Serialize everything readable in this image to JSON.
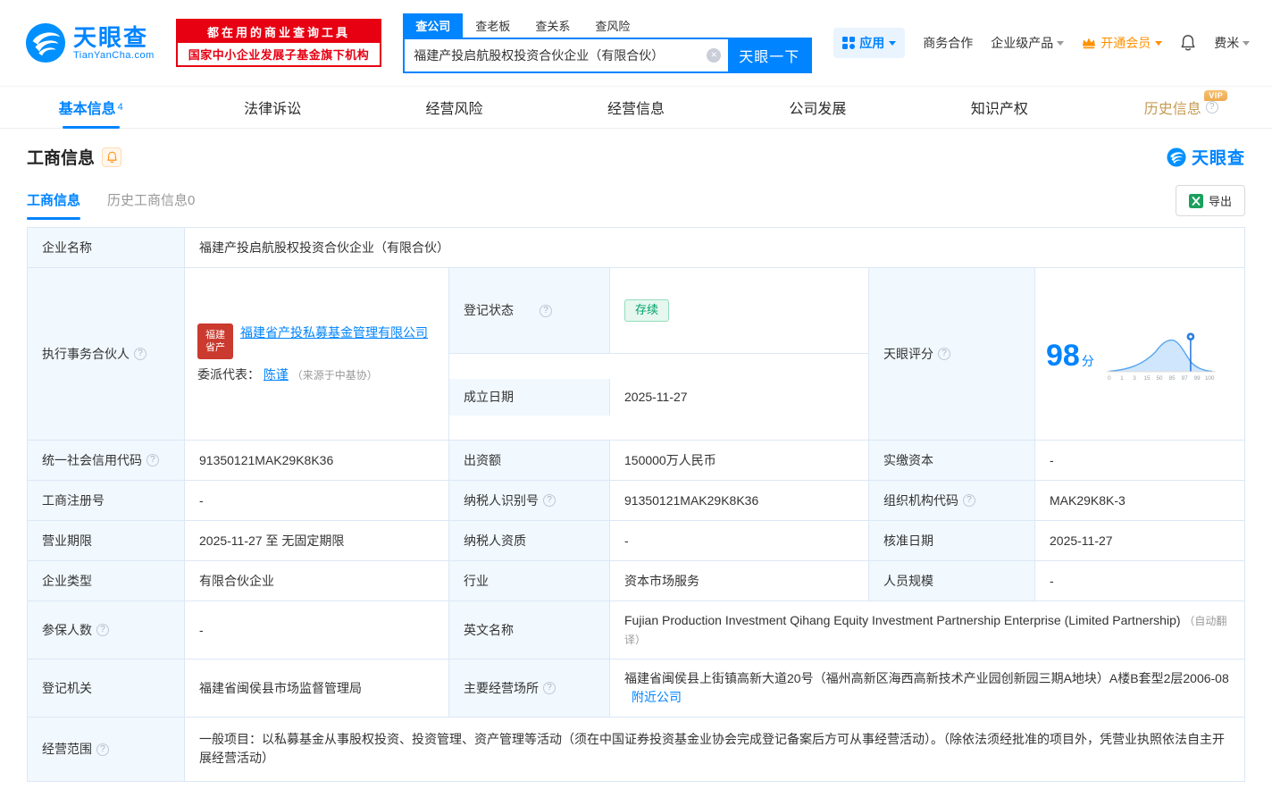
{
  "brand": {
    "name": "天眼查",
    "domain": "TianYanCha.com",
    "primary_color": "#0084ff"
  },
  "header": {
    "slogan_line1": "都在用的商业查询工具",
    "slogan_line2": "国家中小企业发展子基金旗下机构",
    "search_tabs": [
      {
        "label": "查公司"
      },
      {
        "label": "查老板"
      },
      {
        "label": "查关系"
      },
      {
        "label": "查风险"
      }
    ],
    "search_value": "福建产投启航股权投资合伙企业（有限合伙）",
    "search_button": "天眼一下",
    "apps_label": "应用",
    "cooperation_label": "商务合作",
    "enterprise_label": "企业级产品",
    "vip_label": "开通会员",
    "username": "费米"
  },
  "nav_tabs": [
    {
      "label": "基本信息",
      "count": "4"
    },
    {
      "label": "法律诉讼"
    },
    {
      "label": "经营风险"
    },
    {
      "label": "经营信息"
    },
    {
      "label": "公司发展"
    },
    {
      "label": "知识产权"
    },
    {
      "label": "历史信息",
      "badge": "VIP"
    }
  ],
  "section": {
    "title": "工商信息",
    "logo_text": "天眼查",
    "sub_tab_active": "工商信息",
    "sub_tab_history": "历史工商信息0",
    "export_label": "导出"
  },
  "info": {
    "company_name_label": "企业名称",
    "company_name": "福建产投启航股权投资合伙企业（有限合伙）",
    "partner_label": "执行事务合伙人",
    "partner_logo_line1": "福建",
    "partner_logo_line2": "省产",
    "partner_name": "福建省产投私募基金管理有限公司",
    "delegate_label": "委派代表：",
    "delegate_name": "陈谨",
    "delegate_source": "（来源于中基协）",
    "reg_status_label": "登记状态",
    "reg_status": "存续",
    "establish_date_label": "成立日期",
    "establish_date": "2025-11-27",
    "score_label": "天眼评分",
    "score": "98",
    "score_unit": "分",
    "credit_code_label": "统一社会信用代码",
    "credit_code": "91350121MAK29K8K36",
    "capital_label": "出资额",
    "capital": "150000万人民币",
    "paid_capital_label": "实缴资本",
    "paid_capital": "-",
    "reg_number_label": "工商注册号",
    "reg_number": "-",
    "taxpayer_id_label": "纳税人识别号",
    "taxpayer_id": "91350121MAK29K8K36",
    "org_code_label": "组织机构代码",
    "org_code": "MAK29K8K-3",
    "term_label": "营业期限",
    "term": "2025-11-27 至 无固定期限",
    "taxpayer_quality_label": "纳税人资质",
    "taxpayer_quality": "-",
    "approve_date_label": "核准日期",
    "approve_date": "2025-11-27",
    "company_type_label": "企业类型",
    "company_type": "有限合伙企业",
    "industry_label": "行业",
    "industry": "资本市场服务",
    "staff_label": "人员规模",
    "staff": "-",
    "insured_label": "参保人数",
    "insured": "-",
    "english_label": "英文名称",
    "english_name": "Fujian Production Investment Qihang Equity Investment Partnership Enterprise (Limited Partnership)",
    "english_note": "（自动翻译）",
    "authority_label": "登记机关",
    "authority": "福建省闽侯县市场监督管理局",
    "address_label": "主要经营场所",
    "address": "福建省闽侯县上街镇高新大道20号（福州高新区海西高新技术产业园创新园三期A地块）A楼B套型2层2006-08",
    "nearby_link": "附近公司",
    "scope_label": "经营范围",
    "scope": "一般项目：以私募基金从事股权投资、投资管理、资产管理等活动（须在中国证券投资基金业协会完成登记备案后方可从事经营活动）。（除依法须经批准的项目外，凭营业执照依法自主开展经营活动）"
  },
  "score_chart": {
    "score": 98,
    "x_ticks": [
      "0",
      "1",
      "3",
      "15",
      "50",
      "85",
      "97",
      "99",
      "100"
    ]
  }
}
